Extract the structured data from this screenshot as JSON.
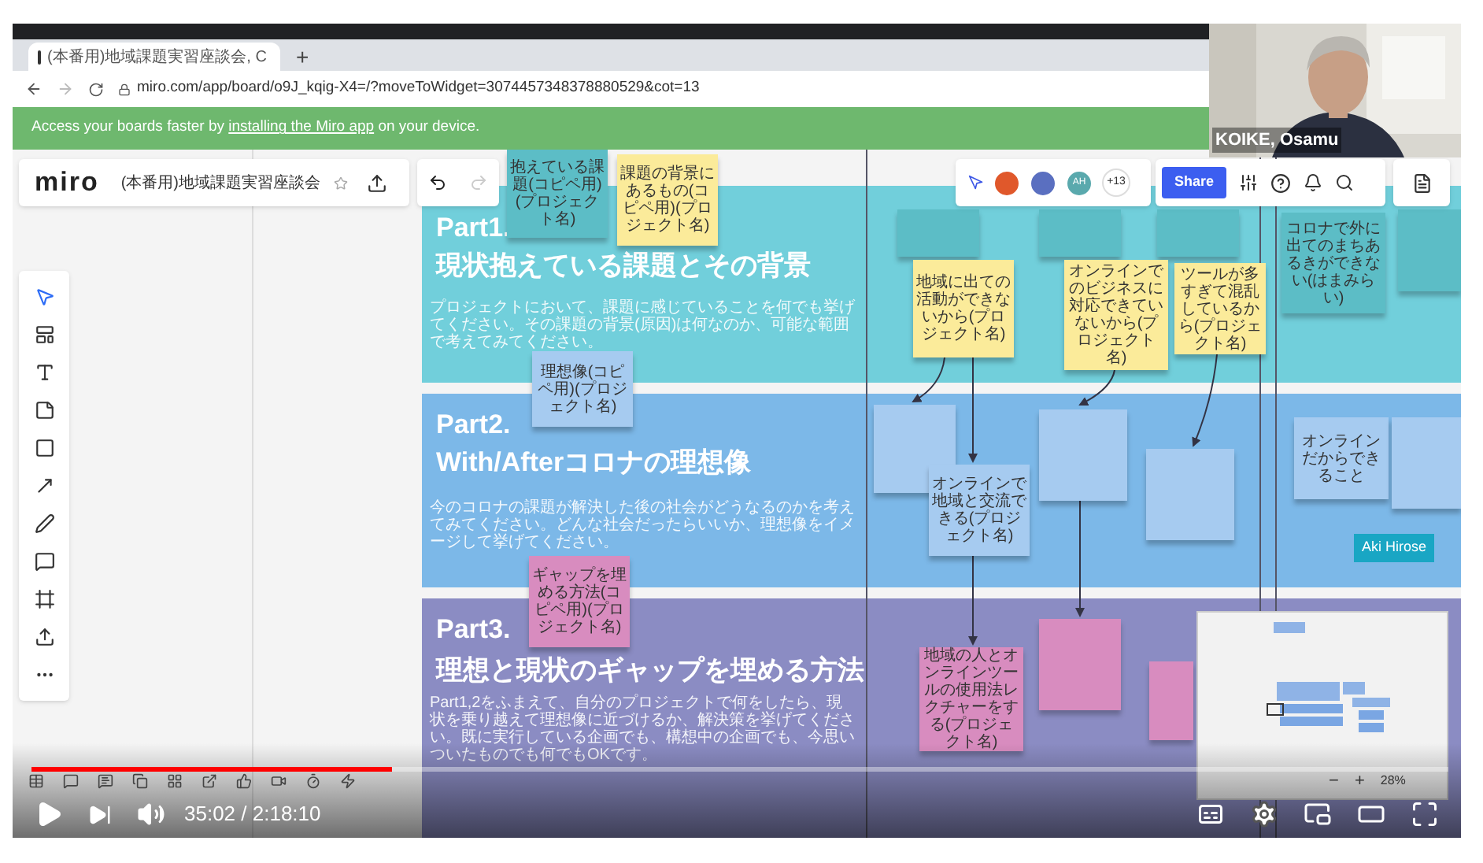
{
  "browser": {
    "tab_title": "(本番用)地域課題実習座談会, C",
    "new_tab": "+",
    "url": "miro.com/app/board/o9J_kqig-X4=/?moveToWidget=3074457348378880529&cot=13"
  },
  "banner": {
    "before": "Access your boards faster by ",
    "link": "installing the Miro app",
    "after": " on your device."
  },
  "board_header": {
    "logo": "miro",
    "title": "(本番用)地域課題実習座談会"
  },
  "collaborators": {
    "avatars": [
      {
        "color": "#e0582b"
      },
      {
        "color": "#5a6fc0"
      },
      {
        "color": "#5aa9ad",
        "initials": "AH"
      }
    ],
    "more": "+13"
  },
  "share_button": "Share",
  "sections": [
    {
      "title": "Part1.",
      "subtitle": "現状抱えている課題とその背景",
      "description": "プロジェクトにおいて、課題に感じていることを何でも挙げてください。その課題の背景(原因)は何なのか、可能な範囲で考えてみてください。",
      "color": "#71cfdb"
    },
    {
      "title": "Part2.",
      "subtitle": "With/Afterコロナの理想像",
      "description": "今のコロナの課題が解決した後の社会がどうなるのかを考えてみてください。どんな社会だったらいいか、理想像をイメージして挙げてください。",
      "color": "#7cb8e8"
    },
    {
      "title": "Part3.",
      "subtitle": "理想と現状のギャップを埋める方法",
      "description": "Part1,2をふまえて、自分のプロジェクトで何をしたら、現状を乗り越えて理想像に近づけるか、解決策を挙げてください。既に実行している企画でも、構想中の企画でも、今思いついたものでも何でもOKです。",
      "color": "#8b8cc3"
    }
  ],
  "stickies": [
    {
      "text": "抱えている課題(コピペ用)(プロジェクト名)",
      "color": "#5cbdc6"
    },
    {
      "text": "課題の背景にあるもの(コピペ用)(プロジェクト名)",
      "color": "#fbeb9a"
    },
    {
      "text": "理想像(コピペ用)(プロジェクト名)",
      "color": "#a6cbf0"
    },
    {
      "text": "ギャップを埋める方法(コピペ用)(プロジェクト名)",
      "color": "#d88cbf"
    },
    {
      "color": "#5cbdc6"
    },
    {
      "color": "#5cbdc6"
    },
    {
      "color": "#5cbdc6"
    },
    {
      "color": "#5cbdc6"
    },
    {
      "text": "コロナで外に出てのまちあるきができない(はまみらい)",
      "color": "#5cbdc6"
    },
    {
      "text": "地域に出ての活動ができないから(プロジェクト名)",
      "color": "#fbeb9a"
    },
    {
      "text": "オンラインでのビジネスに対応できていないから(プロジェクト名)",
      "color": "#fbeb9a"
    },
    {
      "text": "ツールが多すぎて混乱しているから(プロジェクト名)",
      "color": "#fbeb9a"
    },
    {
      "color": "#a6cbf0"
    },
    {
      "text": "オンラインで地域と交流できる(プロジェクト名)",
      "color": "#a6cbf0"
    },
    {
      "color": "#a6cbf0"
    },
    {
      "color": "#a6cbf0"
    },
    {
      "text": "オンラインだからできること",
      "color": "#a6cbf0"
    },
    {
      "color": "#a6cbf0"
    },
    {
      "text": "地域の人とオンラインツールの使用法レクチャーをする(プロジェクト名)",
      "color": "#d88cbf"
    },
    {
      "color": "#d88cbf"
    },
    {
      "color": "#d88cbf"
    }
  ],
  "cursor_label": "Aki Hirose",
  "zoom": {
    "out": "−",
    "in": "+",
    "level": "28%"
  },
  "webcam": {
    "name": "KOIKE, Osamu"
  },
  "player": {
    "playing": false,
    "level": 0.254,
    "time": "35:02 / 2:18:10"
  }
}
